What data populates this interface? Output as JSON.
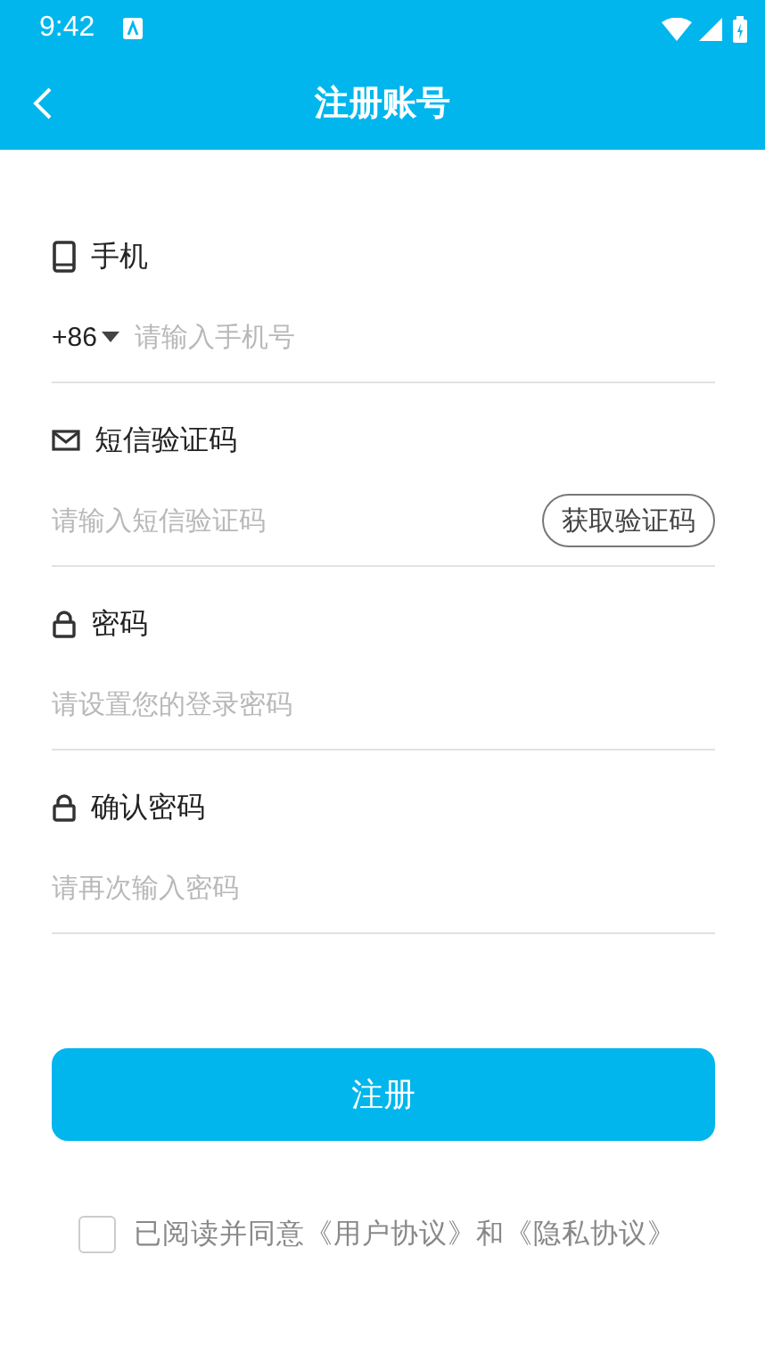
{
  "status_bar": {
    "time": "9:42"
  },
  "header": {
    "title": "注册账号"
  },
  "fields": [
    {
      "kind": "phone",
      "label": "手机",
      "prefix": "+86",
      "placeholder": "请输入手机号"
    },
    {
      "kind": "code",
      "label": "短信验证码",
      "placeholder": "请输入短信验证码",
      "action": "获取验证码"
    },
    {
      "kind": "password",
      "label": "密码",
      "placeholder": "请设置您的登录密码"
    },
    {
      "kind": "password",
      "label": "确认密码",
      "placeholder": "请再次输入密码"
    }
  ],
  "submit": "注册",
  "agreement": {
    "checked": false,
    "text": "已阅读并同意《用户协议》和《隐私协议》"
  }
}
